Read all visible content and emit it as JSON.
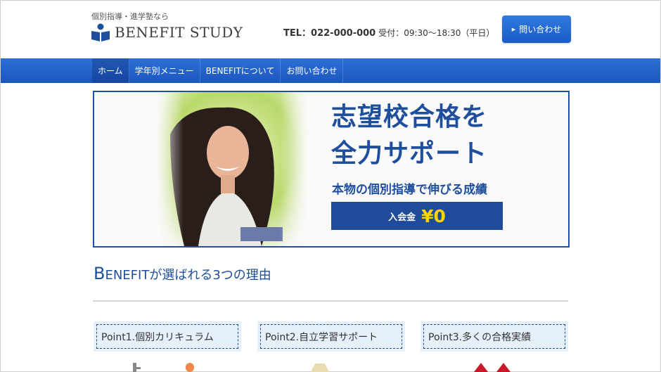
{
  "header": {
    "tagline": "個別指導・進学塾なら",
    "logo_text": "BENEFIT STUDY",
    "tel_label": "TEL：022-000-000",
    "hours": "受付：09:30〜18:30（平日）",
    "contact_button": "問い合わせ",
    "logo_icon": "book-person-icon"
  },
  "nav": {
    "items": [
      {
        "label": "ホーム"
      },
      {
        "label": "学年別メニュー"
      },
      {
        "label": "BENEFITについて"
      },
      {
        "label": "お問い合わせ"
      }
    ],
    "active_index": 0
  },
  "hero": {
    "line1": "志望校合格を",
    "line2": "全力サポート",
    "subtitle": "本物の個別指導で伸びる成績",
    "fee_label": "入会金",
    "fee_value": "¥0"
  },
  "section": {
    "title_initial": "B",
    "title_rest": "ENEFITが選ばれる3つの理由",
    "points": [
      {
        "label": "Point1.個別カリキュラム"
      },
      {
        "label": "Point2.自立学習サポート"
      },
      {
        "label": "Point3.多くの合格実績"
      }
    ]
  },
  "colors": {
    "brand_blue": "#1f4f9c",
    "nav_blue": "#2c70d6",
    "accent_yellow": "#ffd400",
    "point_bg": "#e6f0fb"
  }
}
